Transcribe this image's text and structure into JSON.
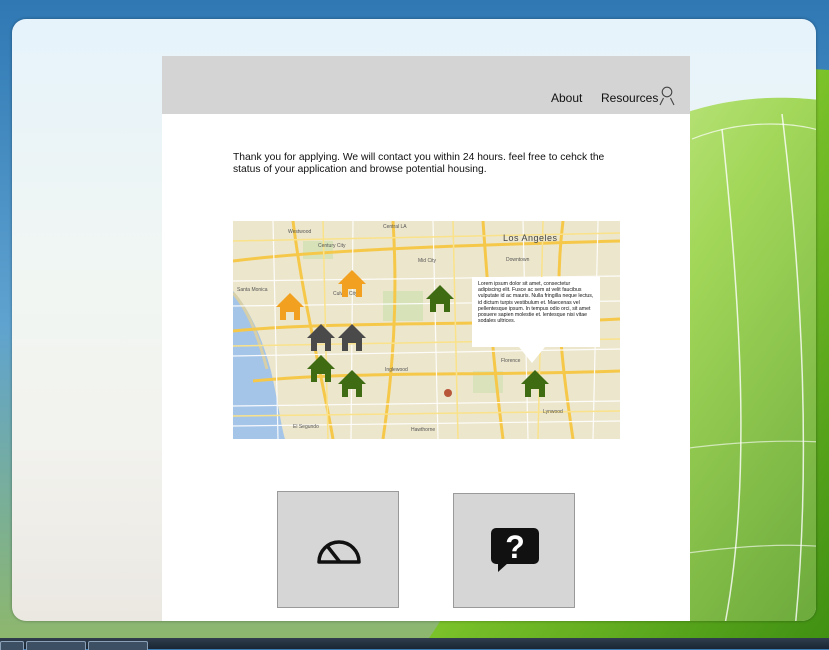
{
  "nav": {
    "about": "About",
    "resources": "Resources"
  },
  "intro_text": "Thank you for applying. We will contact you within 24 hours. feel free to cehck the status of your application and browse potential housing.",
  "map": {
    "city_label": "Los Angeles",
    "callout_text": "Lorem ipsum dolor sit amet, consectetur adipiscing elit. Fusce ac sem at velit faucibus vulputate id ac mauris. Nulla fringilla neque lectus, id dictum turpis vestibulum et. Maecenas vel pellentesque ipsum. In tempus odio orci, sit amet posuere sapien molestie et. lentesque nisi vitae sodales ultrices.",
    "small_labels": [
      "Central LA",
      "Westwood",
      "Century City",
      "Culver City",
      "Santa Monica",
      "Inglewood",
      "El Segundo",
      "Hawthorne",
      "Lynwood",
      "Downtown",
      "Florence",
      "Mid City"
    ],
    "house_colors": {
      "orange": "#f2a01f",
      "gray": "#4a4a4a",
      "green": "#3f6b12"
    }
  },
  "tiles": {
    "dashboard_icon": "gauge-icon",
    "help_icon": "question-bubble-icon"
  }
}
